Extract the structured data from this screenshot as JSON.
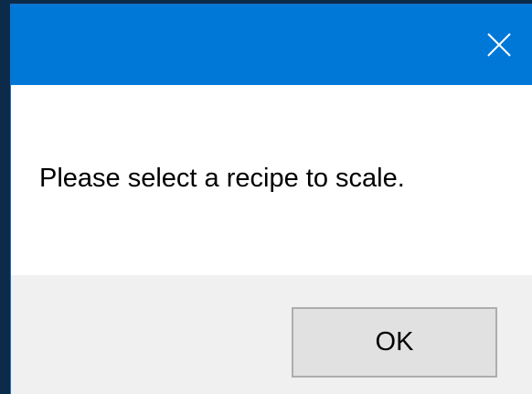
{
  "dialog": {
    "title": "",
    "message": "Please select a recipe to scale.",
    "ok_label": "OK",
    "close_icon": "close-icon"
  },
  "colors": {
    "titlebar": "#0078d7",
    "content_bg": "#ffffff",
    "footer_bg": "#f0f0f0",
    "button_bg": "#e1e1e1",
    "button_border": "#adadad"
  }
}
